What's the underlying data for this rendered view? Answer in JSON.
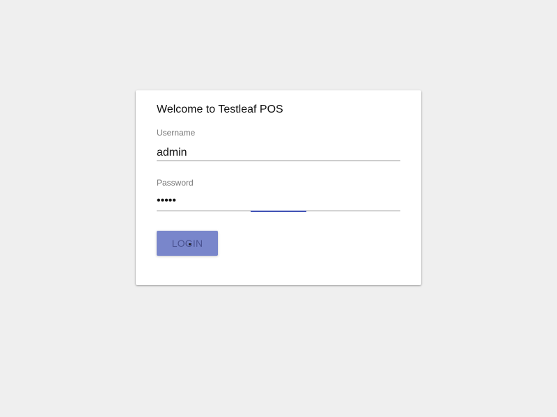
{
  "login_card": {
    "title": "Welcome to Testleaf POS",
    "username": {
      "label": "Username",
      "value": "admin"
    },
    "password": {
      "label": "Password",
      "masked_value": "•••••"
    },
    "login_button_label": "LOGIN"
  },
  "colors": {
    "background": "#efefef",
    "card": "#ffffff",
    "accent": "#3f51b5",
    "button": "#7986cb"
  }
}
